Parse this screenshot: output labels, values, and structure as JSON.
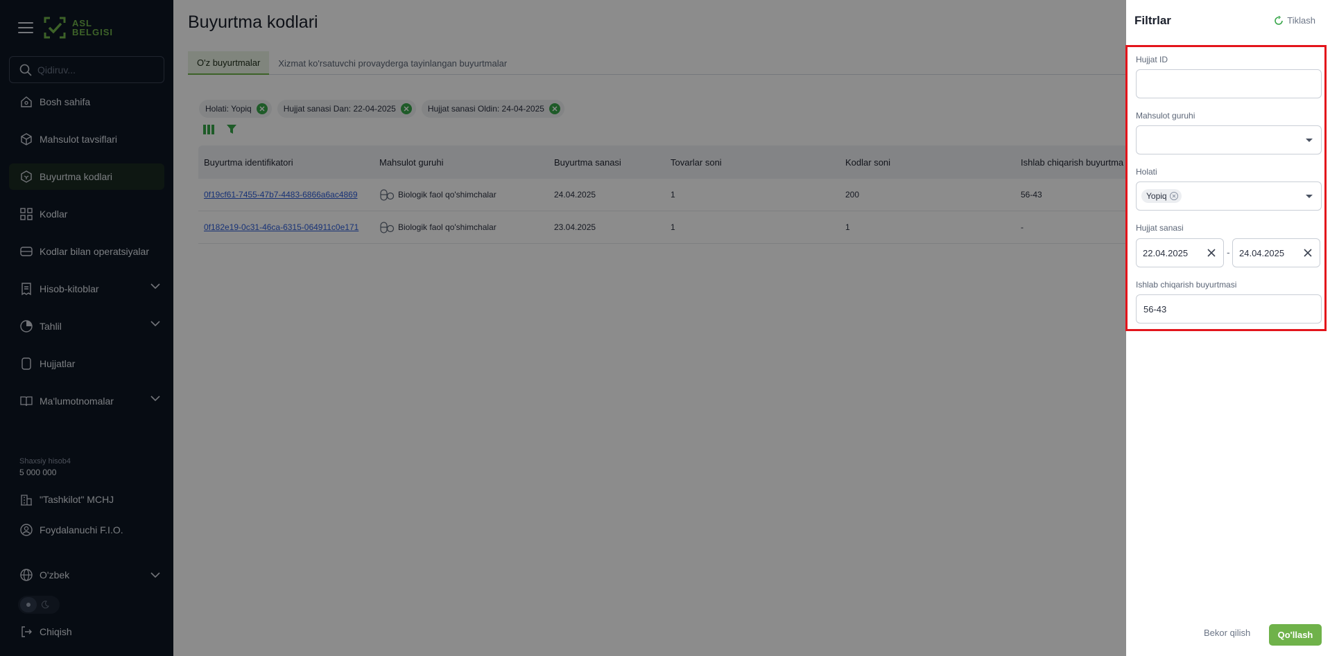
{
  "brand": {
    "name_line1": "ASL",
    "name_line2": "BELGISI",
    "accent": "#6fb24a"
  },
  "search": {
    "placeholder": "Qidiruv..."
  },
  "sidebar": {
    "items": [
      {
        "label": "Bosh sahifa",
        "icon": "home-icon"
      },
      {
        "label": "Mahsulot tavsiflari",
        "icon": "box-icon"
      },
      {
        "label": "Buyurtma kodlari",
        "icon": "box-code-icon",
        "active": true
      },
      {
        "label": "Kodlar",
        "icon": "qr-icon"
      },
      {
        "label": "Kodlar bilan operatsiyalar",
        "icon": "operations-icon"
      },
      {
        "label": "Hisob-kitoblar",
        "icon": "receipt-icon",
        "expandable": true
      },
      {
        "label": "Tahlil",
        "icon": "chart-icon",
        "expandable": true
      },
      {
        "label": "Hujjatlar",
        "icon": "document-icon"
      },
      {
        "label": "Ma'lumotnomalar",
        "icon": "book-icon",
        "expandable": true
      }
    ],
    "account_label": "Shaxsiy hisob4",
    "account_value": "5 000 000",
    "organization": "\"Tashkilot\" MCHJ",
    "user": "Foydalanuchi F.I.O.",
    "language": "O'zbek",
    "logout": "Chiqish"
  },
  "main": {
    "title": "Buyurtma kodlari",
    "tabs": [
      {
        "label": "O'z buyurtmalar",
        "active": true
      },
      {
        "label": "Xizmat ko'rsatuvchi provayderga tayinlangan buyurtmalar"
      }
    ],
    "chips": [
      "Holati: Yopiq",
      "Hujjat sanasi Dan: 22-04-2025",
      "Hujjat sanasi Oldin: 24-04-2025"
    ],
    "table": {
      "headers": [
        "Buyurtma identifikatori",
        "Mahsulot guruhi",
        "Buyurtma sanasi",
        "Tovarlar soni",
        "Kodlar soni",
        "Ishlab chiqarish buyurtma"
      ],
      "rows": [
        [
          "0f19cf61-7455-47b7-4483-6866a6ac4869",
          "Biologik faol qo'shimchalar",
          "24.04.2025",
          "1",
          "200",
          "56-43"
        ],
        [
          "0f182e19-0c31-46ca-6315-064911c0e171",
          "Biologik faol qo'shimchalar",
          "23.04.2025",
          "1",
          "1",
          "-"
        ]
      ]
    }
  },
  "filters": {
    "title": "Filtrlar",
    "reset_label": "Tiklash",
    "doc_id_label": "Hujjat ID",
    "doc_id_value": "",
    "product_group_label": "Mahsulot guruhi",
    "product_group_value": "",
    "status_label": "Holati",
    "status_tag": "Yopiq",
    "doc_date_label": "Hujjat sanasi",
    "date_from": "22.04.2025",
    "date_separator": "-",
    "date_to": "24.04.2025",
    "production_order_label": "Ishlab chiqarish buyurtmasi",
    "production_order_value": "56-43",
    "cancel_label": "Bekor qilish",
    "apply_label": "Qo'llash"
  }
}
